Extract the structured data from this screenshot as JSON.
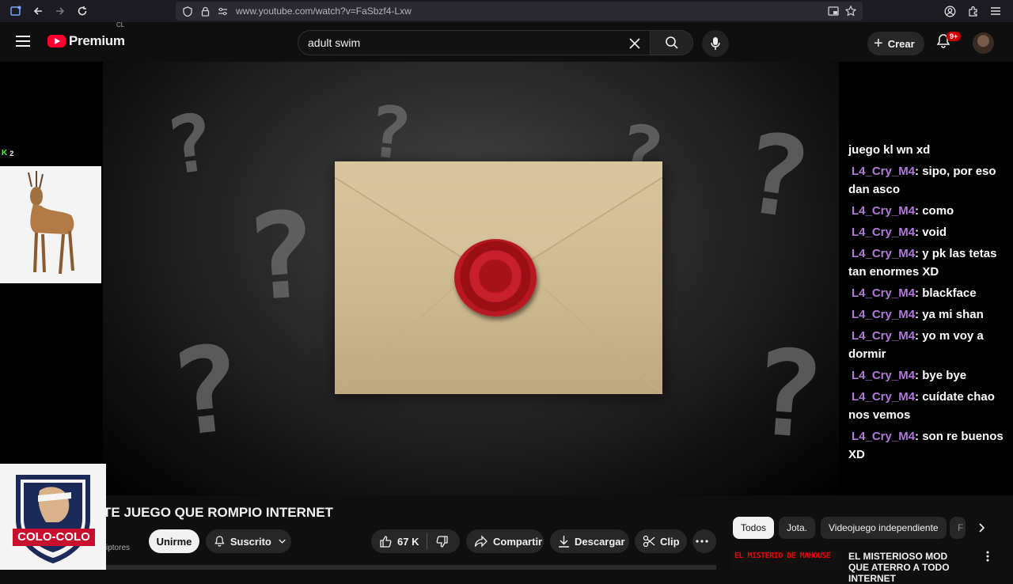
{
  "browser": {
    "url": "www.youtube.com/watch?v=FaSbzf4-Lxw"
  },
  "header": {
    "logo_text": "Premium",
    "country_code": "CL",
    "search_value": "adult swim",
    "create_label": "Crear",
    "notification_count": "9+"
  },
  "overlay": {
    "badge_letter": "K",
    "badge_count": "2"
  },
  "chat": {
    "partial_first": "juego kl wn xd",
    "messages": [
      {
        "user": "L4_Cry_M4",
        "text": ": sipo, por eso dan asco"
      },
      {
        "user": "L4_Cry_M4",
        "text": ": como"
      },
      {
        "user": "L4_Cry_M4",
        "text": ": void"
      },
      {
        "user": "L4_Cry_M4",
        "text": ": y pk las tetas tan enormes XD"
      },
      {
        "user": "L4_Cry_M4",
        "text": ": blackface"
      },
      {
        "user": "L4_Cry_M4",
        "text": ": ya mi shan"
      },
      {
        "user": "L4_Cry_M4",
        "text": ": yo m voy a dormir"
      },
      {
        "user": "L4_Cry_M4",
        "text": ": bye bye"
      },
      {
        "user": "L4_Cry_M4",
        "text": ": cuídate chao nos vemos"
      },
      {
        "user": "L4_Cry_M4",
        "text": ": son re buenos XD"
      }
    ]
  },
  "video": {
    "title": "TE JUEGO QUE ROMPIO INTERNET",
    "subs_partial": "iptores",
    "join_label": "Unirme",
    "subscribed_label": "Suscrito",
    "likes": "67 K",
    "share_label": "Compartir",
    "download_label": "Descargar",
    "clip_label": "Clip"
  },
  "chips": [
    "Todos",
    "Jota.",
    "Videojuego independiente",
    "F"
  ],
  "recommendation": {
    "thumb_text": "EL MISTERIO DE MAHOUSE",
    "title": "EL MISTERIOSO MOD QUE ATERRO A TODO INTERNET"
  },
  "crest": {
    "text": "COLO-COLO"
  },
  "colors": {
    "brand_red": "#ff0033",
    "chat_user": "#b07ad8",
    "kick_green": "#53fc18"
  }
}
